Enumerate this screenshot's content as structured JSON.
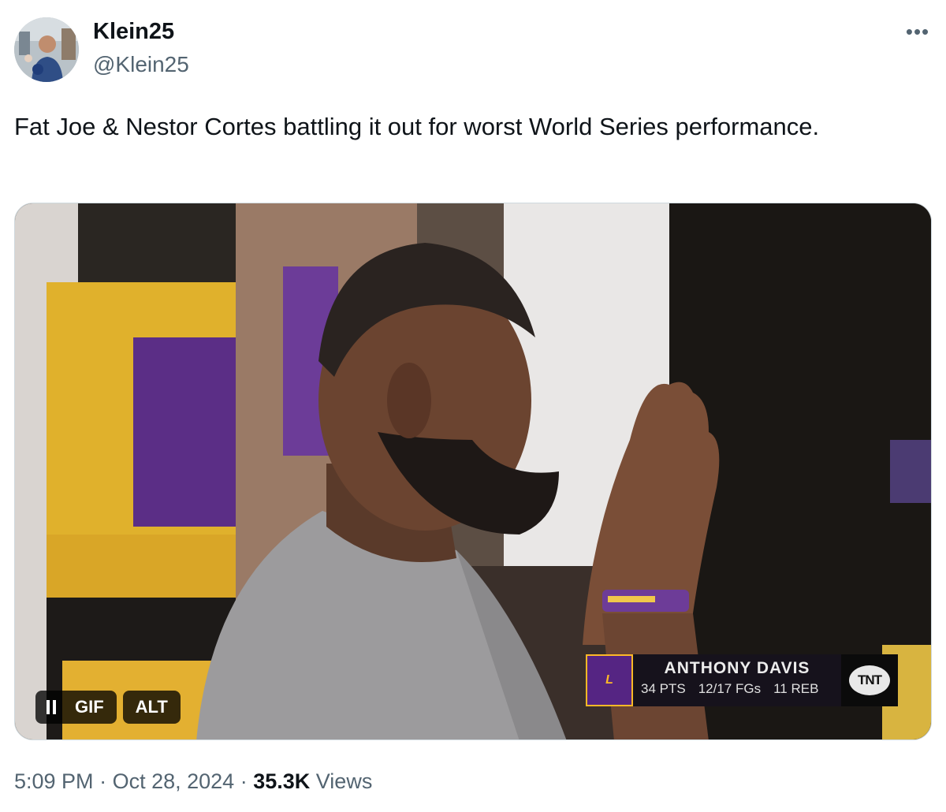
{
  "author": {
    "display_name": "Klein25",
    "handle": "@Klein25"
  },
  "tweet": {
    "text": "Fat Joe & Nestor Cortes battling it out for worst World Series performance."
  },
  "media": {
    "gif_label": "GIF",
    "alt_label": "ALT",
    "overlay": {
      "name": "ANTHONY DAVIS",
      "pts": "34 PTS",
      "fgs": "12/17 FGs",
      "reb": "11 REB",
      "network": "TNT"
    }
  },
  "meta": {
    "time": "5:09 PM",
    "date": "Oct 28, 2024",
    "views_count": "35.3K",
    "views_label": "Views"
  },
  "colors": {
    "lakers_purple": "#552583",
    "lakers_gold": "#fdb927",
    "secondary_text": "#536471"
  }
}
